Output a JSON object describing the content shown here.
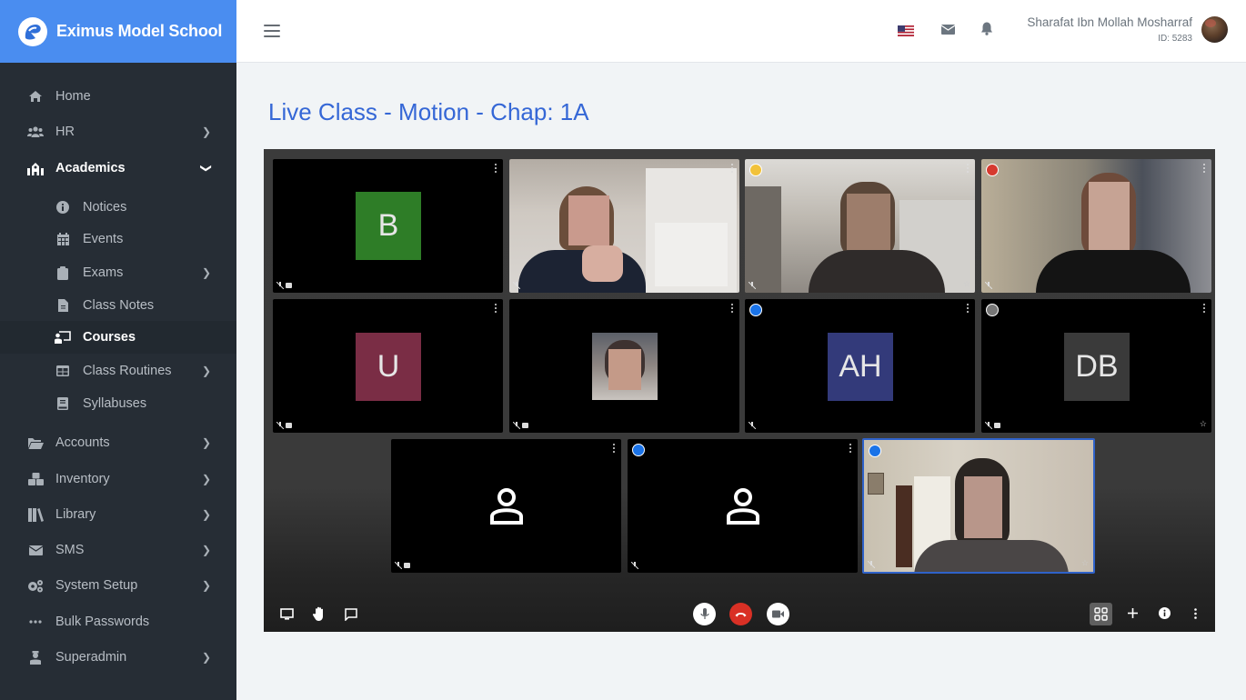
{
  "brand": {
    "name": "Eximus Model School",
    "logo_icon": "eximus-logo-icon"
  },
  "sidebar": {
    "items": [
      {
        "label": "Home",
        "icon": "home-icon",
        "has_children": false
      },
      {
        "label": "HR",
        "icon": "users-icon",
        "has_children": true
      },
      {
        "label": "Academics",
        "icon": "school-icon",
        "has_children": true,
        "expanded": true,
        "children": [
          {
            "label": "Notices",
            "icon": "info-circle-icon",
            "has_children": false
          },
          {
            "label": "Events",
            "icon": "calendar-icon",
            "has_children": false
          },
          {
            "label": "Exams",
            "icon": "clipboard-icon",
            "has_children": true
          },
          {
            "label": "Class Notes",
            "icon": "file-icon",
            "has_children": false
          },
          {
            "label": "Courses",
            "icon": "chalkboard-teacher-icon",
            "has_children": false,
            "current": true
          },
          {
            "label": "Class Routines",
            "icon": "table-icon",
            "has_children": true
          },
          {
            "label": "Syllabuses",
            "icon": "book-icon",
            "has_children": false
          }
        ]
      },
      {
        "label": "Accounts",
        "icon": "folder-open-icon",
        "has_children": true
      },
      {
        "label": "Inventory",
        "icon": "boxes-icon",
        "has_children": true
      },
      {
        "label": "Library",
        "icon": "books-icon",
        "has_children": true
      },
      {
        "label": "SMS",
        "icon": "envelope-icon",
        "has_children": true
      },
      {
        "label": "System Setup",
        "icon": "cogs-icon",
        "has_children": true
      },
      {
        "label": "Bulk Passwords",
        "icon": "ellipsis-icon",
        "has_children": false
      },
      {
        "label": "Superadmin",
        "icon": "user-tie-icon",
        "has_children": true
      }
    ]
  },
  "topbar": {
    "language": "en-US",
    "user": {
      "name": "Sharafat Ibn Mollah Mosharraf",
      "id_label": "ID: 5283"
    }
  },
  "page": {
    "title": "Live Class - Motion - Chap: 1A"
  },
  "meeting": {
    "tiles": [
      {
        "type": "initials",
        "initials": "B",
        "color": "#2e7d27",
        "mic_off": true,
        "cam_off": true
      },
      {
        "type": "video",
        "mic_off": true
      },
      {
        "type": "video",
        "badge_color": "#f2c23a",
        "mic_off": true,
        "pinnable": true
      },
      {
        "type": "video",
        "badge_color": "#d63a2f",
        "mic_off": true
      },
      {
        "type": "initials",
        "initials": "U",
        "color": "#7a2d45",
        "mic_off": true,
        "cam_off": true
      },
      {
        "type": "photo",
        "mic_off": true,
        "cam_off": true
      },
      {
        "type": "initials",
        "initials": "AH",
        "color": "#333a7a",
        "badge_color": "#1a73e8",
        "mic_off": true
      },
      {
        "type": "initials",
        "initials": "DB",
        "color": "#3a3a3a",
        "badge_color": "#777777",
        "mic_off": true,
        "cam_off": true,
        "pinnable": true
      },
      {
        "type": "avatar",
        "mic_off": true,
        "cam_off": true
      },
      {
        "type": "avatar",
        "badge_color": "#1a73e8",
        "mic_off": true
      },
      {
        "type": "video",
        "badge_color": "#1a73e8",
        "active_speaker": true,
        "pinnable": true
      }
    ],
    "controls": {
      "left": [
        "present-screen-icon",
        "raise-hand-icon",
        "chat-icon"
      ],
      "center": [
        "microphone-icon",
        "hang-up-icon",
        "camera-icon"
      ],
      "right": [
        "grid-layout-icon",
        "add-icon",
        "info-icon",
        "more-vertical-icon"
      ]
    },
    "colors": {
      "hangup": "#d93025",
      "active_border": "#2f62c9"
    }
  }
}
